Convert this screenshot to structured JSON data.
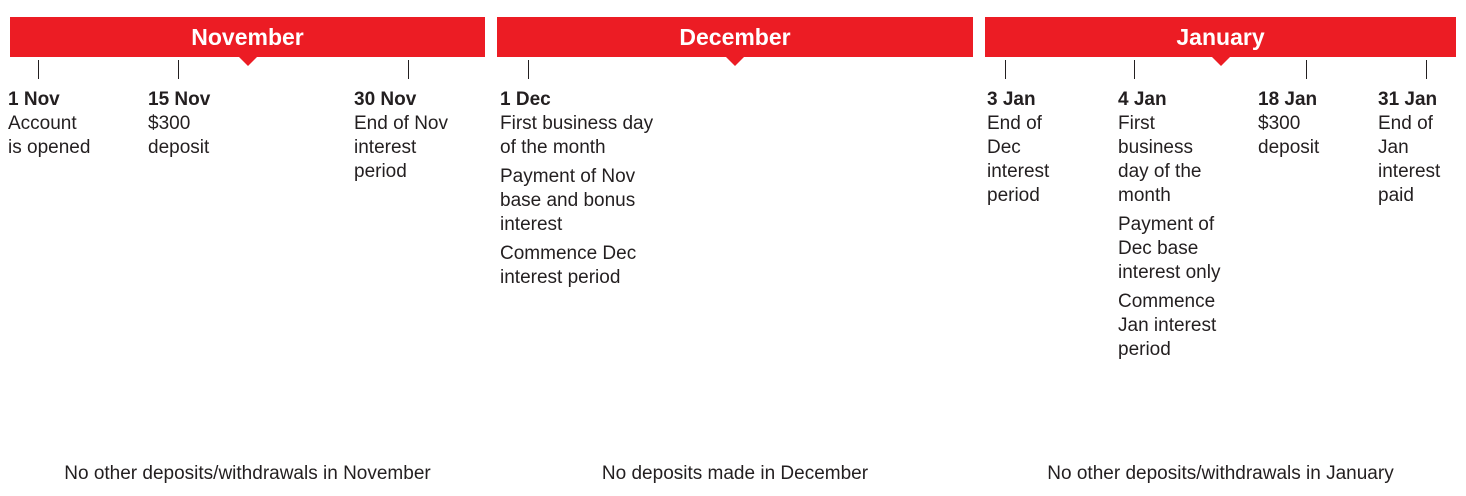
{
  "months": {
    "november": "November",
    "december": "December",
    "january": "January"
  },
  "events": {
    "nov1": {
      "date": "1 Nov",
      "desc": [
        "Account\nis opened"
      ]
    },
    "nov15": {
      "date": "15 Nov",
      "desc": [
        "$300\ndeposit"
      ]
    },
    "nov30": {
      "date": "30 Nov",
      "desc": [
        "End of Nov\ninterest\nperiod"
      ]
    },
    "dec1": {
      "date": "1 Dec",
      "desc": [
        "First business day\nof the month",
        "Payment of Nov\nbase and bonus\ninterest",
        "Commence Dec\ninterest period"
      ]
    },
    "jan3": {
      "date": "3 Jan",
      "desc": [
        "End of\nDec\ninterest\nperiod"
      ]
    },
    "jan4": {
      "date": "4 Jan",
      "desc": [
        "First\nbusiness\nday of the\nmonth",
        "Payment of\nDec base\ninterest only",
        "Commence\nJan interest\nperiod"
      ]
    },
    "jan18": {
      "date": "18 Jan",
      "desc": [
        "$300\ndeposit"
      ]
    },
    "jan31": {
      "date": "31 Jan",
      "desc": [
        "End of\nJan\ninterest\npaid"
      ]
    }
  },
  "notes": {
    "november": "No other deposits/withdrawals in November",
    "december": "No deposits made in December",
    "january": "No other deposits/withdrawals in January"
  },
  "colors": {
    "accent": "#ec1c24",
    "text": "#231f20"
  }
}
